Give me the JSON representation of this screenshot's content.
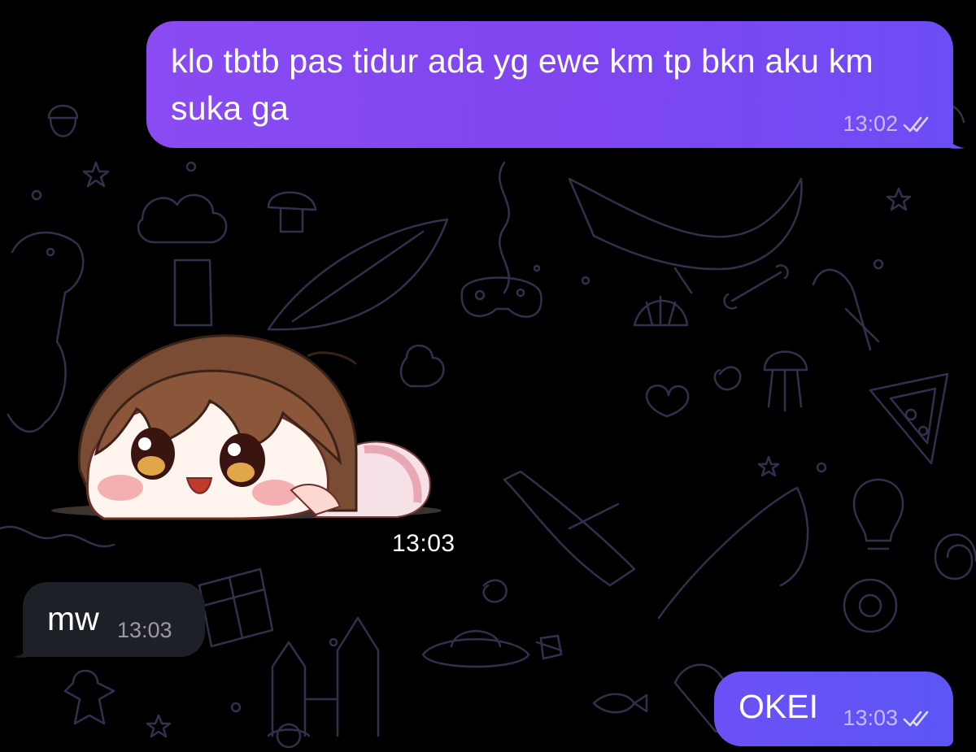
{
  "colors": {
    "background": "#000000",
    "outgoing_bubble": "#8a4bf2",
    "outgoing_bubble_2": "#6b50f5",
    "incoming_bubble": "#1e2027",
    "wallpaper_doodle": "#3a3556"
  },
  "messages": [
    {
      "direction": "outgoing",
      "text": "klo tbtb pas tidur ada yg ewe km tp bkn aku km suka ga",
      "time": "13:02",
      "status": "double-check-read"
    },
    {
      "direction": "incoming",
      "type": "sticker",
      "sticker_icon": "crying-girl-sticker-icon",
      "time": "13:03"
    },
    {
      "direction": "incoming",
      "text": "mw",
      "time": "13:03"
    },
    {
      "direction": "outgoing",
      "text": "OKEI",
      "time": "13:03",
      "status": "double-check-read"
    }
  ]
}
